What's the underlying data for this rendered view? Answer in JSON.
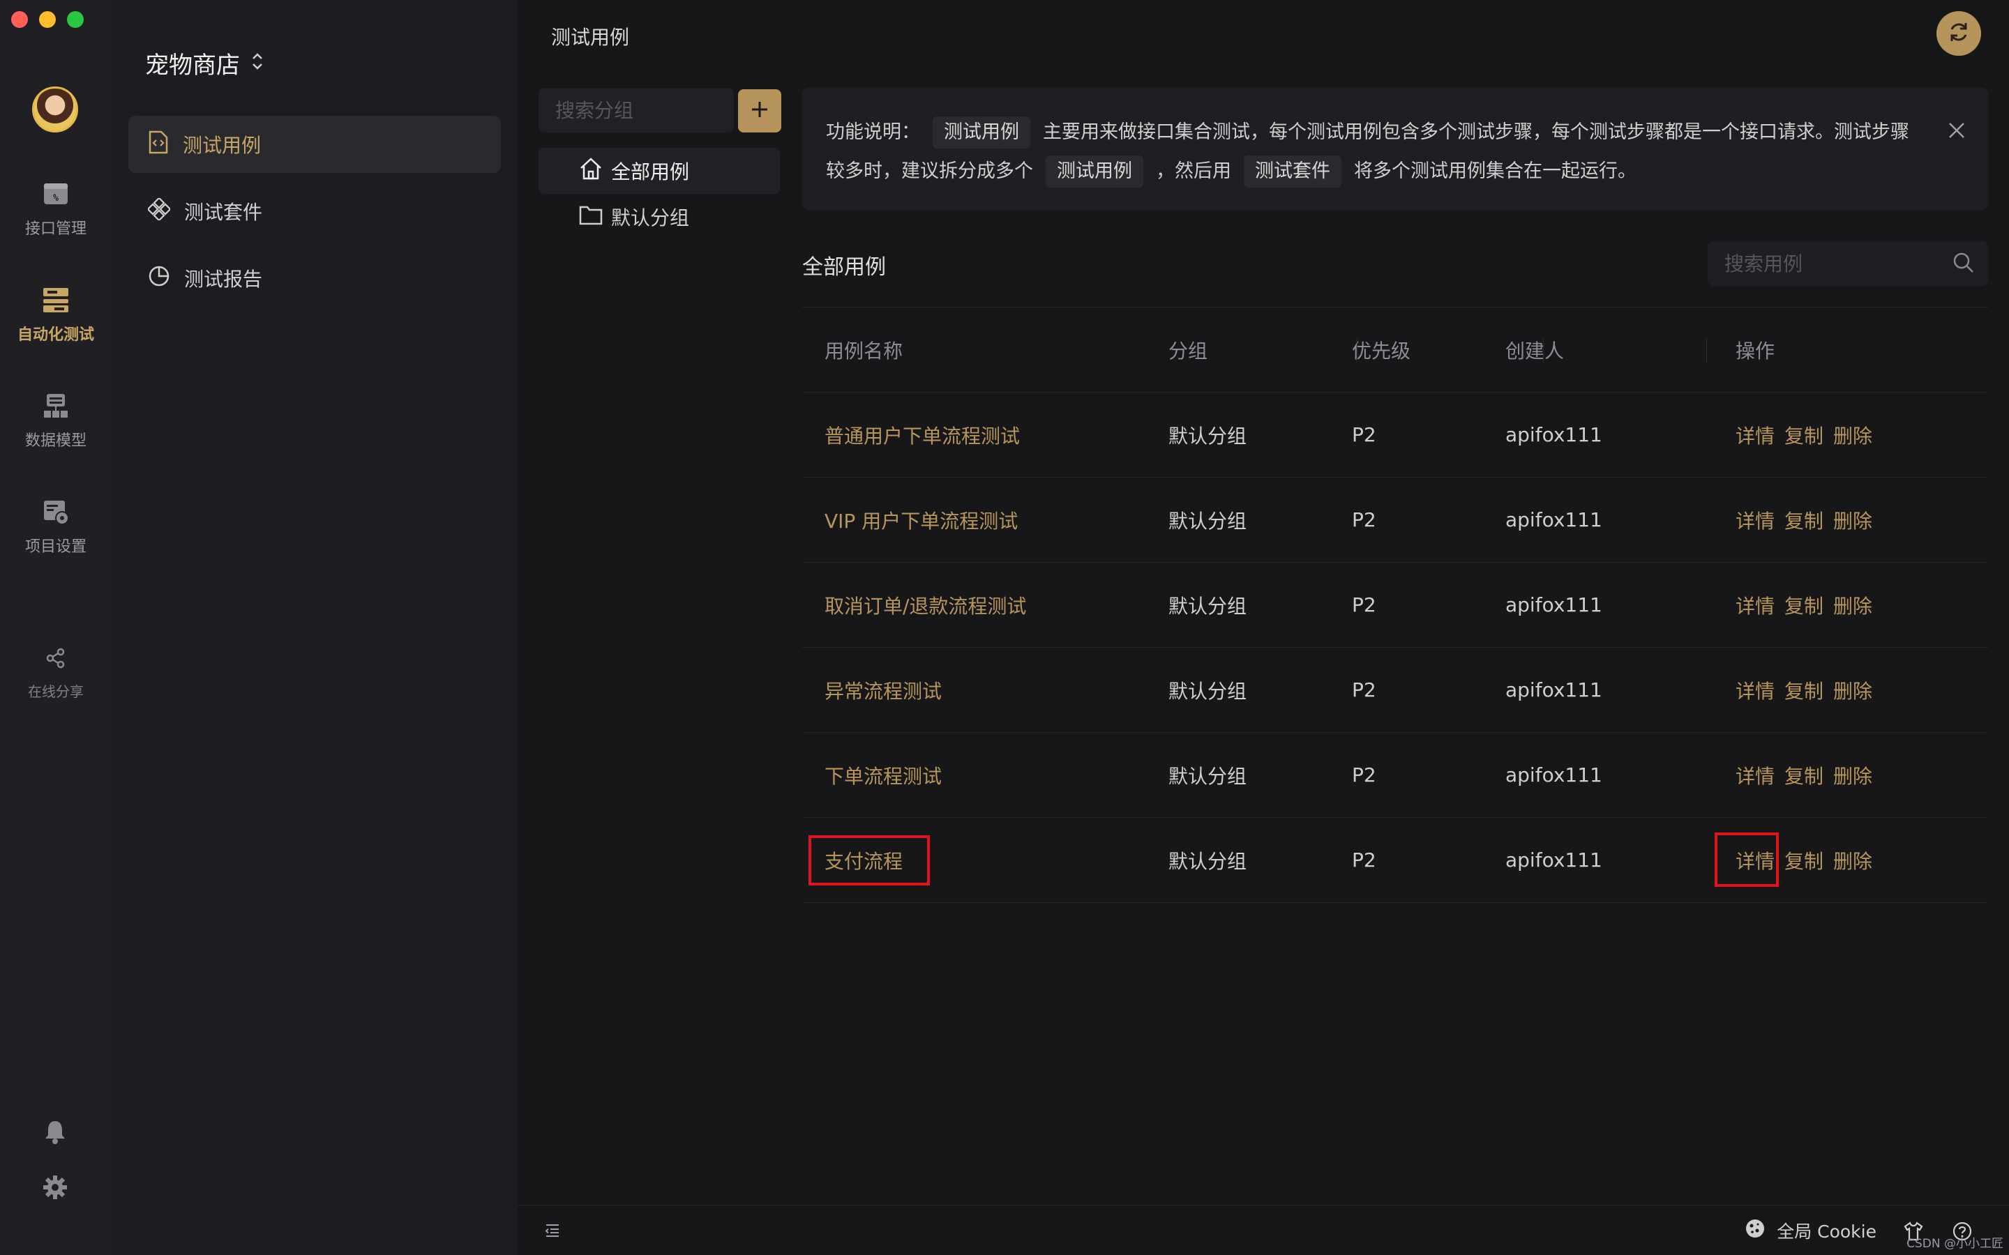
{
  "app": {
    "accent": "#b5935a",
    "link_color": "#b8955b",
    "highlight_color": "#e0141e"
  },
  "rail": {
    "items": [
      {
        "label": "接口管理",
        "icon": "api-icon"
      },
      {
        "label": "自动化测试",
        "icon": "automation-icon"
      },
      {
        "label": "数据模型",
        "icon": "data-model-icon"
      },
      {
        "label": "项目设置",
        "icon": "project-settings-icon"
      }
    ],
    "share_label": "在线分享"
  },
  "sidebar": {
    "project_name": "宠物商店",
    "items": [
      {
        "label": "测试用例",
        "icon": "test-case-icon"
      },
      {
        "label": "测试套件",
        "icon": "test-suite-icon"
      },
      {
        "label": "测试报告",
        "icon": "test-report-icon"
      }
    ]
  },
  "header": {
    "title": "测试用例"
  },
  "groups": {
    "search_placeholder": "搜索分组",
    "items": [
      {
        "label": "全部用例",
        "icon": "home-icon"
      },
      {
        "label": "默认分组",
        "icon": "folder-icon"
      }
    ]
  },
  "notice": {
    "prefix": "功能说明：",
    "tag1": "测试用例",
    "text1": "主要用来做接口集合测试，每个测试用例包含多个测试步骤，每个测试步骤都是一个接口请求。测试步骤较多时，建议拆分成多个",
    "tag2": "测试用例",
    "text2": "，然后用",
    "tag3": "测试套件",
    "text3": "将多个测试用例集合在一起运行。"
  },
  "list": {
    "title": "全部用例",
    "search_placeholder": "搜索用例",
    "columns": [
      "用例名称",
      "分组",
      "优先级",
      "创建人",
      "操作"
    ],
    "rows": [
      {
        "name": "普通用户下单流程测试",
        "group": "默认分组",
        "priority": "P2",
        "owner": "apifox111"
      },
      {
        "name": "VIP 用户下单流程测试",
        "group": "默认分组",
        "priority": "P2",
        "owner": "apifox111"
      },
      {
        "name": "取消订单/退款流程测试",
        "group": "默认分组",
        "priority": "P2",
        "owner": "apifox111"
      },
      {
        "name": "异常流程测试",
        "group": "默认分组",
        "priority": "P2",
        "owner": "apifox111"
      },
      {
        "name": "下单流程测试",
        "group": "默认分组",
        "priority": "P2",
        "owner": "apifox111"
      },
      {
        "name": "支付流程",
        "group": "默认分组",
        "priority": "P2",
        "owner": "apifox111"
      }
    ],
    "actions": {
      "detail": "详情",
      "copy": "复制",
      "delete": "删除"
    }
  },
  "bottombar": {
    "cookie_label": "全局 Cookie"
  },
  "watermark": "CSDN @小小工匠"
}
